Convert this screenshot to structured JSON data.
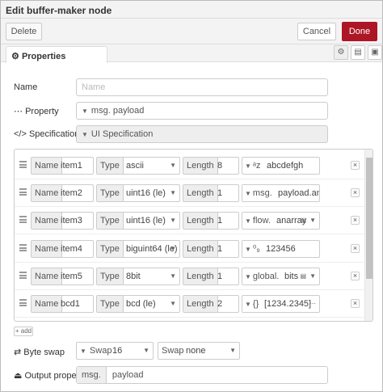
{
  "header": {
    "title": "Edit buffer-maker node"
  },
  "toolbar": {
    "delete_label": "Delete",
    "cancel_label": "Cancel",
    "done_label": "Done"
  },
  "tabs": {
    "properties_label": "Properties",
    "icons": [
      "gear-icon",
      "description-icon",
      "appearance-icon"
    ]
  },
  "form": {
    "name": {
      "label": "Name",
      "placeholder": "Name",
      "value": ""
    },
    "property": {
      "label": "Property",
      "prefix": "msg.",
      "value": "payload"
    },
    "specification": {
      "label": "Specification",
      "value": "UI Specification"
    },
    "byte_swap": {
      "label": "Byte swap",
      "swap_label": "Swap",
      "swap_value": "16",
      "swap2_label": "Swap",
      "swap2_value": "none"
    },
    "output_property": {
      "label": "Output property",
      "prefix": "msg.",
      "value": "payload"
    }
  },
  "items": [
    {
      "name_label": "Name",
      "name": "item1",
      "type_label": "Type",
      "type": "ascii",
      "length_label": "Length",
      "length": "8",
      "value_prefix": "ᵃz",
      "value": "abcdefgh"
    },
    {
      "name_label": "Name",
      "name": "item2",
      "type_label": "Type",
      "type": "uint16 (le)",
      "length_label": "Length",
      "length": "1",
      "value_prefix": "msg.",
      "value": "payload.anumb"
    },
    {
      "name_label": "Name",
      "name": "item3",
      "type_label": "Type",
      "type": "uint16 (le)",
      "length_label": "Length",
      "length": "1",
      "value_prefix": "flow.",
      "value": "anarray"
    },
    {
      "name_label": "Name",
      "name": "item4",
      "type_label": "Type",
      "type": "biguint64 (le)",
      "length_label": "Length",
      "length": "1",
      "value_prefix": "⁰₉",
      "value": "123456"
    },
    {
      "name_label": "Name",
      "name": "item5",
      "type_label": "Type",
      "type": "8bit",
      "length_label": "Length",
      "length": "1",
      "value_prefix": "global.",
      "value": "bits"
    },
    {
      "name_label": "Name",
      "name": "bcd1",
      "type_label": "Type",
      "type": "bcd (le)",
      "length_label": "Length",
      "length": "2",
      "value_prefix": "{}",
      "value": "[1234.2345]"
    }
  ],
  "add_label": "+ add",
  "accent_color": "#ad1625"
}
